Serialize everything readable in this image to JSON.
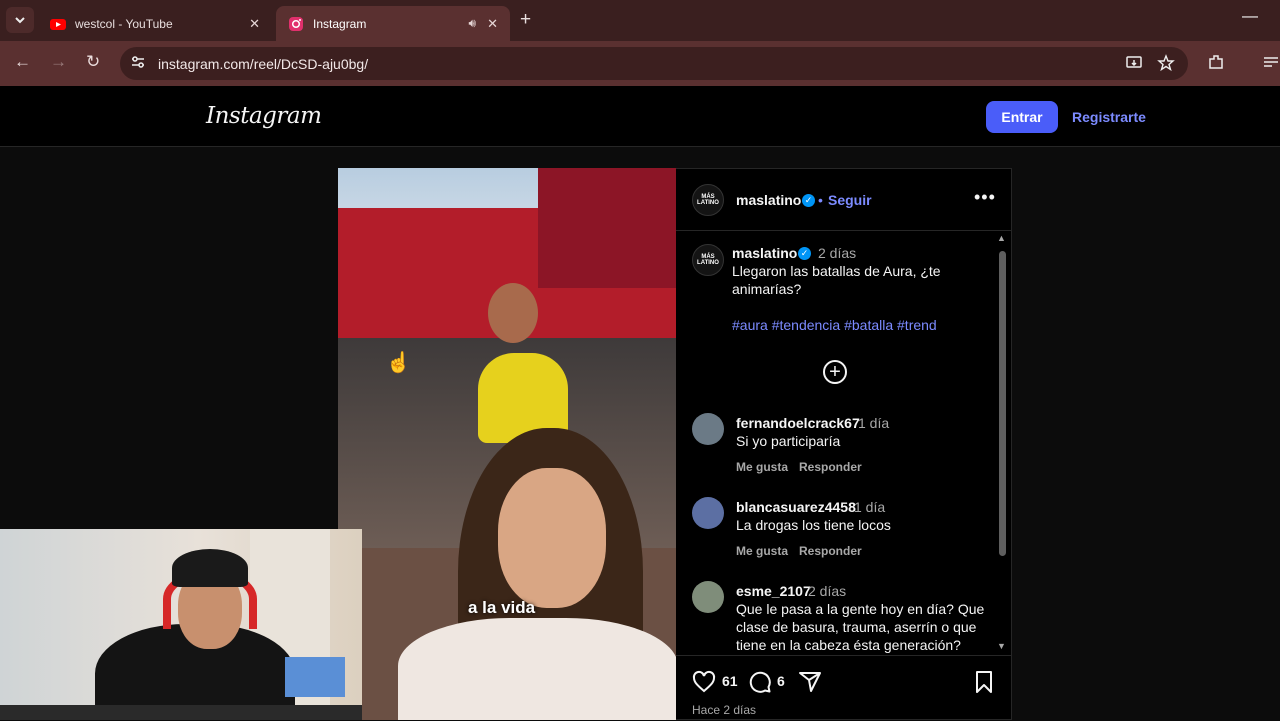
{
  "browser": {
    "tabs": [
      {
        "title": "westcol - YouTube",
        "favicon": "youtube-icon",
        "color": "#ff0000",
        "active": false
      },
      {
        "title": "Instagram",
        "favicon": "instagram-icon",
        "color": "#e1306c",
        "active": true
      }
    ],
    "url": "instagram.com/reel/DcSD-aju0bg/"
  },
  "header": {
    "logo": "Instagram",
    "login_label": "Entrar",
    "signup_label": "Registrarte"
  },
  "reel": {
    "overlay_caption": "a la vida"
  },
  "post": {
    "author": "maslatino",
    "avatar_text": "MÁS LATINO",
    "follow_label": "Seguir",
    "separator": "•",
    "more_label": "•••",
    "caption": {
      "author": "maslatino",
      "time": "2 días",
      "text_line1": "Llegaron las batallas de Aura, ¿te",
      "text_line2": "animarías?",
      "hashtags": "#aura #tendencia #batalla #trend"
    },
    "comments": [
      {
        "user": "fernandoelcrack67",
        "time": "1 día",
        "text": "Si yo participaría",
        "like": "Me gusta",
        "reply": "Responder",
        "avatar_color": "#6b7a86"
      },
      {
        "user": "blancasuarez4458",
        "time": "1 día",
        "text": "La drogas los tiene locos",
        "like": "Me gusta",
        "reply": "Responder",
        "avatar_color": "#5c6fa3"
      },
      {
        "user": "esme_2107",
        "time": "2 días",
        "text_line1": "Que le pasa a la gente hoy en día? Que",
        "text_line2": "clase de basura, trauma, aserrín o que",
        "text_line3": "tiene en la cabeza ésta generación?",
        "avatar_color": "#7f8d7a"
      }
    ],
    "likes": "61",
    "comment_count": "6",
    "posted": "Hace 2 días"
  }
}
